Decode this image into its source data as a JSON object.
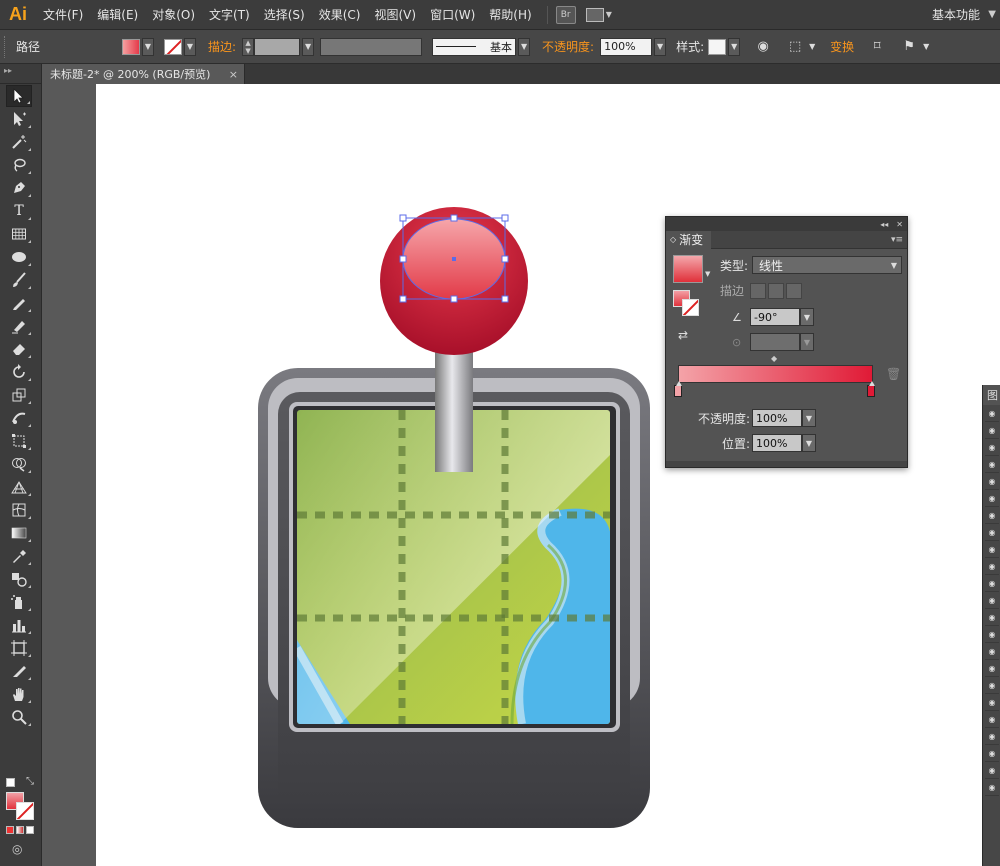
{
  "app": {
    "logo": "Ai",
    "menu": [
      "文件(F)",
      "编辑(E)",
      "对象(O)",
      "文字(T)",
      "选择(S)",
      "效果(C)",
      "视图(V)",
      "窗口(W)",
      "帮助(H)"
    ],
    "bridge_label": "Br",
    "workspace": "基本功能"
  },
  "control_bar": {
    "selection": "路径",
    "stroke_label": "描边:",
    "stroke_profile": "基本",
    "opacity_label": "不透明度:",
    "opacity_value": "100%",
    "style_label": "样式:",
    "transform_label": "变换"
  },
  "document": {
    "tab_title": "未标题-2* @ 200% (RGB/预览)",
    "close": "×"
  },
  "gradient_panel": {
    "tab": "渐变",
    "type_label": "类型:",
    "type_value": "线性",
    "stroke_label": "描边",
    "angle_value": "-90°",
    "opacity_label": "不透明度:",
    "opacity_value": "100%",
    "position_label": "位置:",
    "position_value": "100%",
    "start_color": "#f4a3a8",
    "end_color": "#e01a36"
  },
  "layers_panel": {
    "title": "图"
  },
  "icons": {
    "selection": "selection-arrow-icon",
    "direct_selection": "direct-selection-icon",
    "magic_wand": "magic-wand-icon",
    "lasso": "lasso-icon",
    "pen": "pen-icon",
    "type": "type-icon",
    "grid": "rectangular-grid-icon",
    "ellipse": "ellipse-icon",
    "brush": "paintbrush-icon",
    "pencil": "pencil-icon",
    "blob": "blob-brush-icon",
    "eraser": "eraser-icon",
    "rotate": "rotate-icon",
    "scale": "scale-icon",
    "warp": "warp-icon",
    "free_transform": "free-transform-icon",
    "shape_builder": "shape-builder-icon",
    "perspective": "perspective-grid-icon",
    "mesh": "mesh-icon",
    "gradient": "gradient-icon",
    "eyedropper": "eyedropper-icon",
    "blend": "blend-icon",
    "symbol": "symbol-sprayer-icon",
    "graph": "column-graph-icon",
    "artboard": "artboard-icon",
    "slice": "slice-icon",
    "hand": "hand-icon",
    "zoom": "zoom-icon"
  }
}
